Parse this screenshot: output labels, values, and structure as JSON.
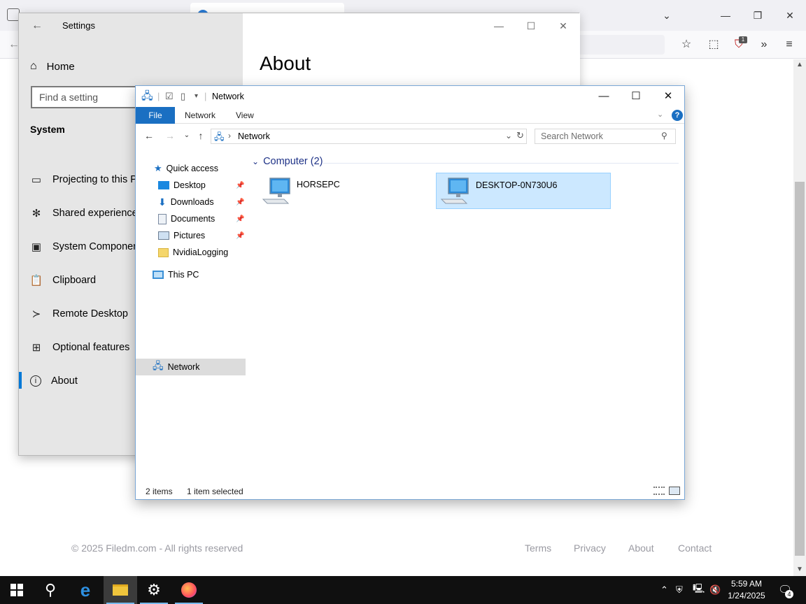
{
  "browser": {
    "footer": {
      "copyright": "© 2025 Filedm.com - All rights reserved",
      "links": [
        "Terms",
        "Privacy",
        "About",
        "Contact"
      ]
    },
    "extension_badge": "1"
  },
  "settings": {
    "title": "Settings",
    "home_label": "Home",
    "search_placeholder": "Find a setting",
    "section": "System",
    "nav_items": [
      {
        "label": "Projecting to this PC",
        "icon": "projector-icon"
      },
      {
        "label": "Shared experiences",
        "icon": "share-icon"
      },
      {
        "label": "System Components",
        "icon": "components-icon"
      },
      {
        "label": "Clipboard",
        "icon": "clipboard-icon"
      },
      {
        "label": "Remote Desktop",
        "icon": "remote-icon"
      },
      {
        "label": "Optional features",
        "icon": "grid-icon"
      },
      {
        "label": "About",
        "icon": "info-icon"
      }
    ],
    "page_heading": "About"
  },
  "explorer": {
    "title": "Network",
    "ribbon_tabs": [
      "File",
      "Network",
      "View"
    ],
    "address": "Network",
    "search_placeholder": "Search Network",
    "nav": {
      "quick_access": "Quick access",
      "items": [
        "Desktop",
        "Downloads",
        "Documents",
        "Pictures",
        "NvidiaLogging"
      ],
      "this_pc": "This PC",
      "network": "Network"
    },
    "group_header": "Computer (2)",
    "computers": [
      "HORSEPC",
      "DESKTOP-0N730U6"
    ],
    "status_items": "2 items",
    "status_selected": "1 item selected"
  },
  "taskbar": {
    "time": "5:59 AM",
    "date": "1/24/2025",
    "notification_count": "4"
  },
  "colors": {
    "accent": "#0078d7",
    "selection": "#cce8ff",
    "file_tab": "#1a6fc2",
    "taskbar": "#101010"
  }
}
